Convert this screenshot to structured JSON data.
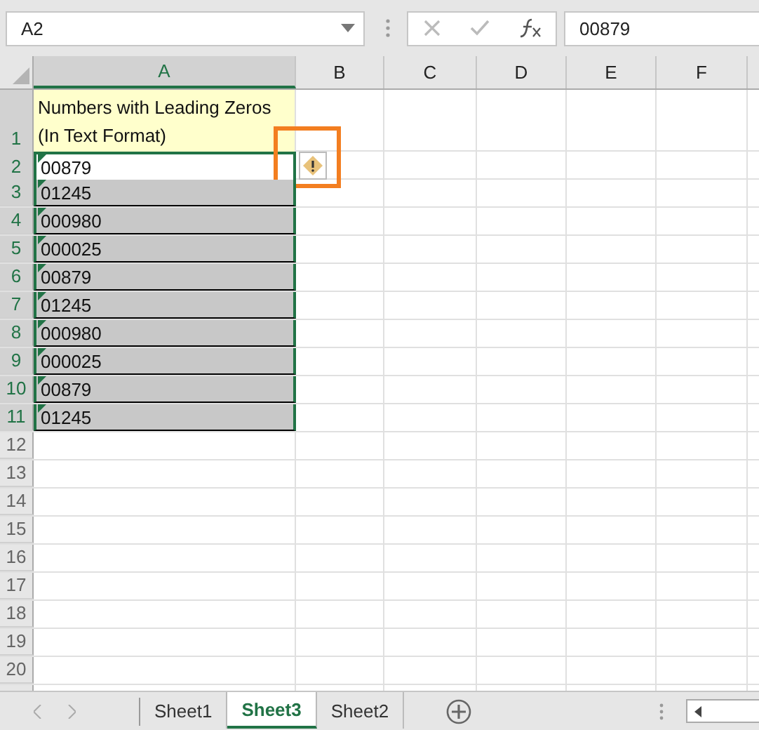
{
  "name_box": {
    "value": "A2"
  },
  "formula_bar": {
    "value": "00879"
  },
  "columns": [
    {
      "label": "A",
      "selected": true
    },
    {
      "label": "B",
      "selected": false
    },
    {
      "label": "C",
      "selected": false
    },
    {
      "label": "D",
      "selected": false
    },
    {
      "label": "E",
      "selected": false
    },
    {
      "label": "F",
      "selected": false
    }
  ],
  "rows": [
    {
      "number": "1",
      "selected": true,
      "cell": {
        "value": "Numbers with Leading Zeros (In Text Format)",
        "kind": "heading"
      }
    },
    {
      "number": "2",
      "selected": true,
      "cell": {
        "value": "00879",
        "kind": "active",
        "text_flag": true
      }
    },
    {
      "number": "3",
      "selected": true,
      "cell": {
        "value": "01245",
        "kind": "selected",
        "text_flag": true
      }
    },
    {
      "number": "4",
      "selected": true,
      "cell": {
        "value": "000980",
        "kind": "selected",
        "text_flag": true
      }
    },
    {
      "number": "5",
      "selected": true,
      "cell": {
        "value": "000025",
        "kind": "selected",
        "text_flag": true
      }
    },
    {
      "number": "6",
      "selected": true,
      "cell": {
        "value": "00879",
        "kind": "selected",
        "text_flag": true
      }
    },
    {
      "number": "7",
      "selected": true,
      "cell": {
        "value": "01245",
        "kind": "selected",
        "text_flag": true
      }
    },
    {
      "number": "8",
      "selected": true,
      "cell": {
        "value": "000980",
        "kind": "selected",
        "text_flag": true
      }
    },
    {
      "number": "9",
      "selected": true,
      "cell": {
        "value": "000025",
        "kind": "selected",
        "text_flag": true
      }
    },
    {
      "number": "10",
      "selected": true,
      "cell": {
        "value": "00879",
        "kind": "selected",
        "text_flag": true
      }
    },
    {
      "number": "11",
      "selected": true,
      "cell": {
        "value": "01245",
        "kind": "selected",
        "text_flag": true
      }
    },
    {
      "number": "12",
      "selected": false
    },
    {
      "number": "13",
      "selected": false
    },
    {
      "number": "14",
      "selected": false
    },
    {
      "number": "15",
      "selected": false
    },
    {
      "number": "16",
      "selected": false
    },
    {
      "number": "17",
      "selected": false
    },
    {
      "number": "18",
      "selected": false
    },
    {
      "number": "19",
      "selected": false
    },
    {
      "number": "20",
      "selected": false
    }
  ],
  "sheet_tabs": [
    {
      "label": "Sheet1",
      "selected": false
    },
    {
      "label": "Sheet3",
      "selected": true
    },
    {
      "label": "Sheet2",
      "selected": false
    }
  ]
}
